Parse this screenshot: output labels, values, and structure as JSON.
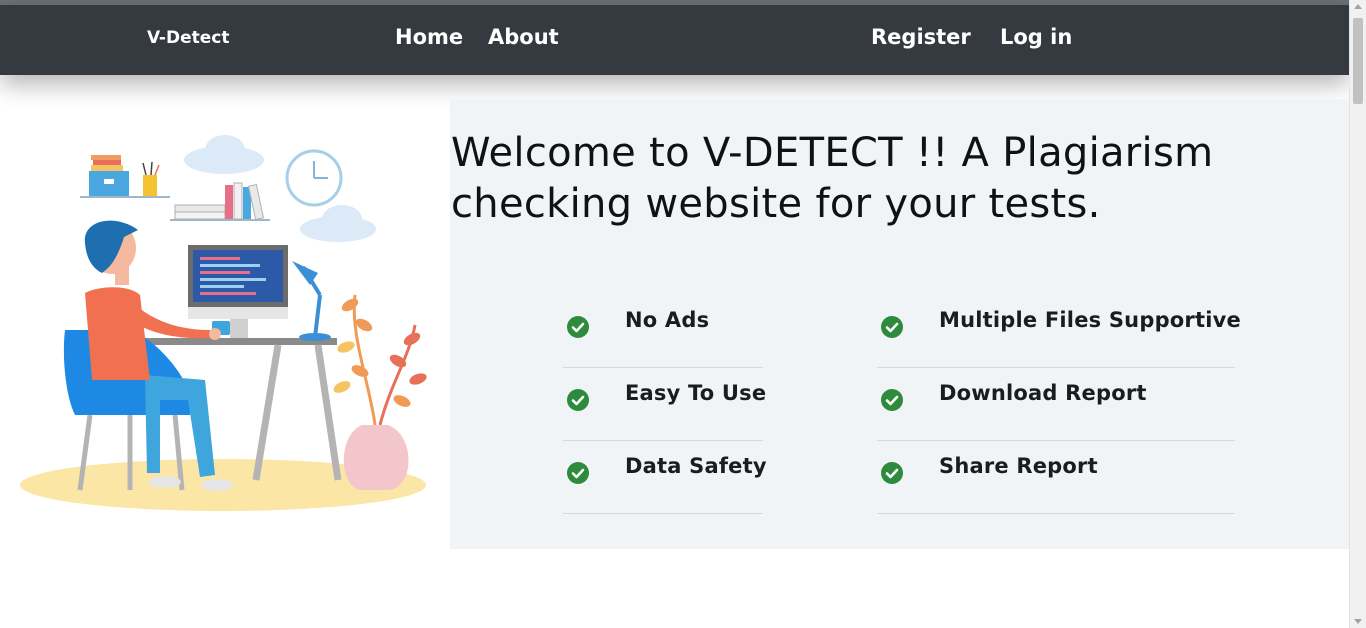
{
  "navbar": {
    "brand": "V-Detect",
    "links": {
      "home": "Home",
      "about": "About",
      "register": "Register",
      "login": "Log in"
    },
    "background": "#343a40"
  },
  "hero": {
    "headline": "Welcome to V-DETECT !! A Plagiarism checking website for your tests.",
    "illustration": "person-at-desk-illustration"
  },
  "features": {
    "left": [
      "No Ads",
      "Easy To Use",
      "Data Safety"
    ],
    "right": [
      "Multiple Files Supportive",
      "Download Report",
      "Share Report"
    ],
    "icon": "check-circle-icon",
    "icon_color": "#2e8a3c"
  }
}
